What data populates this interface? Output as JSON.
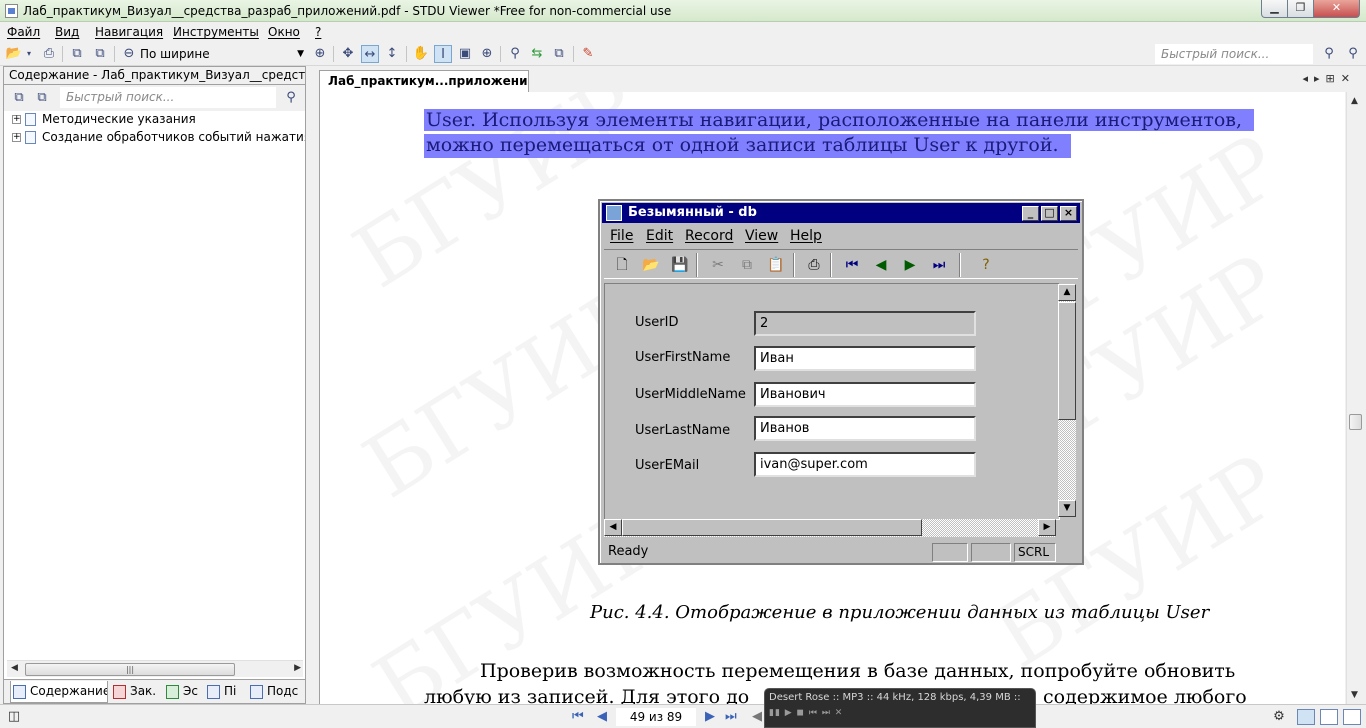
{
  "window": {
    "title": "Лаб_практикум_Визуал__средства_разраб_приложений.pdf - STDU Viewer *Free for non-commercial use"
  },
  "menu": [
    "Файл",
    "Вид",
    "Навигация",
    "Инструменты",
    "Окно",
    "?"
  ],
  "toolbar": {
    "zoom_value": "По ширине",
    "quick_search_placeholder": "Быстрый поиск..."
  },
  "left_panel": {
    "header": "Содержание - Лаб_практикум_Визуал__средства_разраб_приложений.pdf",
    "search_placeholder": "Быстрый поиск...",
    "tree": [
      "Методические указания",
      "Создание обработчиков событий нажатия на кнопку"
    ],
    "tabs": [
      "Содержание",
      "Зак.",
      "Эс",
      "Пі",
      "Подс"
    ]
  },
  "document": {
    "tab_title": "Лаб_практикум...приложений.pdf",
    "selected_line1": "User. Используя элементы навигации, расположенные на панели инструментов,",
    "selected_line2": "можно перемещаться от одной записи таблицы User к другой.",
    "figure": {
      "title": "Безымянный - db",
      "menu": [
        "File",
        "Edit",
        "Record",
        "View",
        "Help"
      ],
      "fields": [
        {
          "label": "UserID",
          "value": "2"
        },
        {
          "label": "UserFirstName",
          "value": "Иван"
        },
        {
          "label": "UserMiddleName",
          "value": "Иванович"
        },
        {
          "label": "UserLastName",
          "value": "Иванов"
        },
        {
          "label": "UserEMail",
          "value": "ivan@super.com"
        }
      ],
      "status": "Ready",
      "status_pane": "SCRL"
    },
    "caption": "Рис. 4.4. Отображение в приложении данных из таблицы User",
    "body_line1": "Проверив возможность перемещения в базе данных, попробуйте обновить",
    "body_line2": "любую из записей. Для этого до",
    "body_line2_end": "содержимое любого",
    "watermark": "БГУИР"
  },
  "status": {
    "page": "49 из 89"
  },
  "media": {
    "line1": "Desert Rose :: MP3 :: 44 kHz, 128 kbps, 4,39 MB ::",
    "line2": ""
  }
}
